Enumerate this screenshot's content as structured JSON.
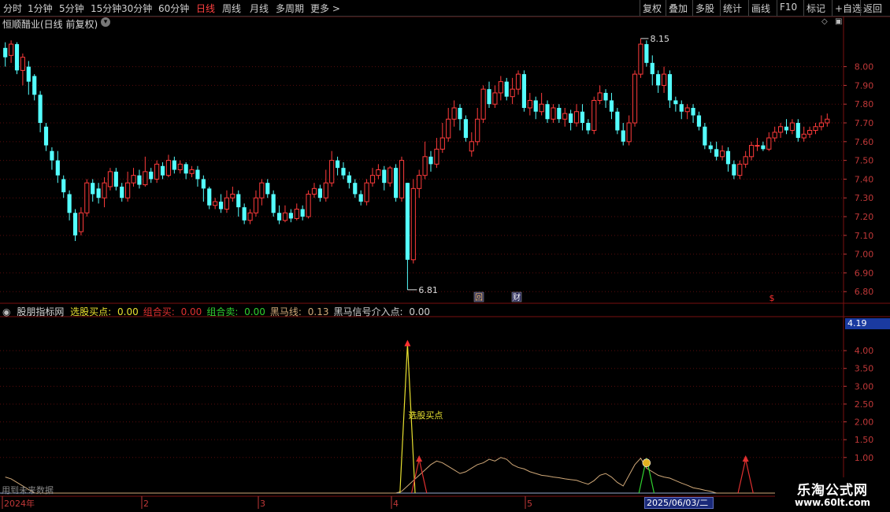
{
  "toolbar": {
    "left": [
      "分时",
      "1分钟",
      "5分钟",
      "15分钟",
      "30分钟",
      "60分钟",
      "日线",
      "周线",
      "月线",
      "多周期",
      "更多 >"
    ],
    "active": "日线",
    "right": [
      "复权",
      "叠加",
      "多股",
      "统计",
      "画线",
      "F10",
      "标记",
      "+自选",
      "返回"
    ]
  },
  "main": {
    "title": "恒顺醋业(日线 前复权)",
    "high_label": "8.15",
    "low_label": "6.81",
    "markers": {
      "review": "回",
      "finance": "财",
      "dollar": "$"
    },
    "price_ticks": [
      "8.00",
      "7.90",
      "7.80",
      "7.70",
      "7.60",
      "7.50",
      "7.40",
      "7.30",
      "7.20",
      "7.10",
      "7.00",
      "6.90",
      "6.80"
    ]
  },
  "indicator": {
    "name": "股朋指标网",
    "items": [
      {
        "label": "选股买点:",
        "value": "0.00",
        "color": "#e8e030"
      },
      {
        "label": "组合买:",
        "value": "0.00",
        "color": "#e03030"
      },
      {
        "label": "组合卖:",
        "value": "0.00",
        "color": "#30d030"
      },
      {
        "label": "黑马线:",
        "value": "0.13",
        "color": "#d0a878"
      },
      {
        "label": "黑马信号介入点:",
        "value": "0.00",
        "color": "#d0d0d0"
      }
    ],
    "current_value": "4.19",
    "ticks": [
      "4.00",
      "3.50",
      "3.00",
      "2.50",
      "2.00",
      "1.50",
      "1.00"
    ],
    "buy_label": "选股买点",
    "future_text": "用到未来数据"
  },
  "date_axis": {
    "labels": [
      "2024年",
      "2",
      "3",
      "4",
      "5"
    ],
    "cursor_date": "2025/06/03/二"
  },
  "colors": {
    "up": "#ff3b3b",
    "down": "#54ffff",
    "grid": "#7a1010",
    "axis": "#c03838"
  },
  "logo": {
    "name": "乐淘公式网",
    "url": "www.60lt.com"
  },
  "chart_data": {
    "type": "candlestick",
    "title": "恒顺醋业(日线 前复权)",
    "ylim": [
      6.78,
      8.2
    ],
    "price_high": 8.15,
    "price_low": 6.81,
    "candles": [
      [
        8.1,
        8.05,
        8.13,
        8.0
      ],
      [
        8.06,
        8.12,
        8.14,
        8.02
      ],
      [
        8.12,
        7.98,
        8.13,
        7.96
      ],
      [
        7.98,
        8.05,
        8.07,
        7.9
      ],
      [
        8.0,
        7.92,
        8.03,
        7.85
      ],
      [
        7.95,
        7.85,
        7.96,
        7.82
      ],
      [
        7.85,
        7.7,
        7.87,
        7.65
      ],
      [
        7.68,
        7.58,
        7.7,
        7.55
      ],
      [
        7.55,
        7.5,
        7.57,
        7.45
      ],
      [
        7.5,
        7.42,
        7.55,
        7.38
      ],
      [
        7.4,
        7.33,
        7.42,
        7.3
      ],
      [
        7.32,
        7.22,
        7.34,
        7.18
      ],
      [
        7.22,
        7.1,
        7.24,
        7.07
      ],
      [
        7.12,
        7.22,
        7.25,
        7.1
      ],
      [
        7.22,
        7.38,
        7.4,
        7.2
      ],
      [
        7.38,
        7.32,
        7.4,
        7.28
      ],
      [
        7.35,
        7.3,
        7.38,
        7.27
      ],
      [
        7.3,
        7.38,
        7.41,
        7.25
      ],
      [
        7.36,
        7.44,
        7.46,
        7.34
      ],
      [
        7.44,
        7.36,
        7.46,
        7.34
      ],
      [
        7.36,
        7.3,
        7.38,
        7.28
      ],
      [
        7.3,
        7.38,
        7.44,
        7.28
      ],
      [
        7.38,
        7.42,
        7.46,
        7.36
      ],
      [
        7.42,
        7.37,
        7.45,
        7.35
      ],
      [
        7.37,
        7.44,
        7.52,
        7.36
      ],
      [
        7.44,
        7.4,
        7.46,
        7.38
      ],
      [
        7.4,
        7.48,
        7.5,
        7.38
      ],
      [
        7.47,
        7.42,
        7.49,
        7.4
      ],
      [
        7.42,
        7.5,
        7.53,
        7.41
      ],
      [
        7.5,
        7.45,
        7.52,
        7.43
      ],
      [
        7.45,
        7.48,
        7.5,
        7.43
      ],
      [
        7.48,
        7.43,
        7.49,
        7.4
      ],
      [
        7.43,
        7.45,
        7.47,
        7.41
      ],
      [
        7.45,
        7.4,
        7.47,
        7.36
      ],
      [
        7.4,
        7.35,
        7.42,
        7.28
      ],
      [
        7.35,
        7.26,
        7.36,
        7.24
      ],
      [
        7.26,
        7.28,
        7.3,
        7.24
      ],
      [
        7.28,
        7.24,
        7.32,
        7.22
      ],
      [
        7.24,
        7.3,
        7.34,
        7.22
      ],
      [
        7.3,
        7.32,
        7.36,
        7.28
      ],
      [
        7.32,
        7.25,
        7.34,
        7.2
      ],
      [
        7.25,
        7.18,
        7.27,
        7.16
      ],
      [
        7.18,
        7.22,
        7.24,
        7.16
      ],
      [
        7.22,
        7.3,
        7.34,
        7.2
      ],
      [
        7.3,
        7.38,
        7.4,
        7.26
      ],
      [
        7.38,
        7.32,
        7.4,
        7.3
      ],
      [
        7.32,
        7.22,
        7.34,
        7.2
      ],
      [
        7.22,
        7.18,
        7.26,
        7.16
      ],
      [
        7.18,
        7.22,
        7.26,
        7.17
      ],
      [
        7.22,
        7.19,
        7.24,
        7.17
      ],
      [
        7.19,
        7.24,
        7.27,
        7.18
      ],
      [
        7.24,
        7.2,
        7.26,
        7.18
      ],
      [
        7.2,
        7.32,
        7.34,
        7.19
      ],
      [
        7.32,
        7.35,
        7.38,
        7.3
      ],
      [
        7.35,
        7.3,
        7.37,
        7.28
      ],
      [
        7.3,
        7.38,
        7.45,
        7.28
      ],
      [
        7.38,
        7.5,
        7.55,
        7.36
      ],
      [
        7.5,
        7.46,
        7.52,
        7.42
      ],
      [
        7.46,
        7.42,
        7.49,
        7.4
      ],
      [
        7.42,
        7.38,
        7.44,
        7.35
      ],
      [
        7.38,
        7.32,
        7.4,
        7.3
      ],
      [
        7.32,
        7.28,
        7.34,
        7.26
      ],
      [
        7.28,
        7.38,
        7.4,
        7.26
      ],
      [
        7.38,
        7.42,
        7.46,
        7.36
      ],
      [
        7.42,
        7.45,
        7.48,
        7.4
      ],
      [
        7.45,
        7.38,
        7.47,
        7.34
      ],
      [
        7.38,
        7.46,
        7.47,
        7.36
      ],
      [
        7.46,
        7.3,
        7.48,
        7.28
      ],
      [
        7.3,
        7.5,
        7.52,
        7.28
      ],
      [
        7.38,
        6.97,
        7.38,
        6.81
      ],
      [
        6.97,
        7.35,
        7.4,
        6.95
      ],
      [
        7.35,
        7.42,
        7.45,
        7.3
      ],
      [
        7.42,
        7.52,
        7.6,
        7.4
      ],
      [
        7.52,
        7.48,
        7.55,
        7.44
      ],
      [
        7.48,
        7.56,
        7.62,
        7.46
      ],
      [
        7.56,
        7.62,
        7.7,
        7.54
      ],
      [
        7.62,
        7.72,
        7.78,
        7.6
      ],
      [
        7.72,
        7.78,
        7.82,
        7.68
      ],
      [
        7.78,
        7.72,
        7.8,
        7.66
      ],
      [
        7.72,
        7.62,
        7.74,
        7.6
      ],
      [
        7.55,
        7.6,
        7.65,
        7.52
      ],
      [
        7.6,
        7.72,
        7.78,
        7.58
      ],
      [
        7.72,
        7.88,
        7.9,
        7.7
      ],
      [
        7.88,
        7.8,
        7.92,
        7.78
      ],
      [
        7.8,
        7.86,
        7.9,
        7.78
      ],
      [
        7.86,
        7.92,
        7.95,
        7.82
      ],
      [
        7.92,
        7.84,
        7.94,
        7.82
      ],
      [
        7.84,
        7.88,
        7.94,
        7.8
      ],
      [
        7.88,
        7.96,
        7.98,
        7.85
      ],
      [
        7.96,
        7.78,
        7.98,
        7.76
      ],
      [
        7.78,
        7.82,
        7.86,
        7.74
      ],
      [
        7.82,
        7.76,
        7.84,
        7.72
      ],
      [
        7.76,
        7.8,
        7.86,
        7.74
      ],
      [
        7.8,
        7.72,
        7.82,
        7.7
      ],
      [
        7.72,
        7.78,
        7.8,
        7.7
      ],
      [
        7.78,
        7.72,
        7.8,
        7.7
      ],
      [
        7.72,
        7.75,
        7.78,
        7.68
      ],
      [
        7.75,
        7.7,
        7.77,
        7.66
      ],
      [
        7.7,
        7.76,
        7.8,
        7.68
      ],
      [
        7.76,
        7.7,
        7.8,
        7.66
      ],
      [
        7.7,
        7.66,
        7.72,
        7.64
      ],
      [
        7.66,
        7.82,
        7.84,
        7.64
      ],
      [
        7.82,
        7.86,
        7.9,
        7.8
      ],
      [
        7.86,
        7.82,
        7.88,
        7.78
      ],
      [
        7.82,
        7.76,
        7.86,
        7.72
      ],
      [
        7.76,
        7.66,
        7.78,
        7.64
      ],
      [
        7.66,
        7.6,
        7.7,
        7.58
      ],
      [
        7.6,
        7.7,
        7.74,
        7.58
      ],
      [
        7.7,
        7.96,
        7.98,
        7.68
      ],
      [
        7.96,
        8.12,
        8.15,
        7.94
      ],
      [
        8.12,
        8.02,
        8.14,
        8.0
      ],
      [
        8.02,
        7.96,
        8.06,
        7.9
      ],
      [
        7.96,
        7.9,
        7.98,
        7.86
      ],
      [
        7.9,
        7.96,
        8.0,
        7.86
      ],
      [
        7.96,
        7.82,
        7.98,
        7.78
      ],
      [
        7.82,
        7.8,
        7.84,
        7.76
      ],
      [
        7.8,
        7.76,
        7.82,
        7.72
      ],
      [
        7.76,
        7.78,
        7.8,
        7.72
      ],
      [
        7.78,
        7.74,
        7.8,
        7.7
      ],
      [
        7.74,
        7.68,
        7.76,
        7.66
      ],
      [
        7.68,
        7.58,
        7.7,
        7.56
      ],
      [
        7.58,
        7.56,
        7.6,
        7.54
      ],
      [
        7.56,
        7.52,
        7.6,
        7.5
      ],
      [
        7.52,
        7.55,
        7.58,
        7.5
      ],
      [
        7.55,
        7.48,
        7.57,
        7.44
      ],
      [
        7.48,
        7.42,
        7.5,
        7.4
      ],
      [
        7.42,
        7.48,
        7.5,
        7.4
      ],
      [
        7.48,
        7.52,
        7.55,
        7.46
      ],
      [
        7.52,
        7.58,
        7.6,
        7.5
      ],
      [
        7.58,
        7.58,
        7.62,
        7.55
      ],
      [
        7.58,
        7.56,
        7.6,
        7.55
      ],
      [
        7.56,
        7.62,
        7.65,
        7.55
      ],
      [
        7.62,
        7.65,
        7.68,
        7.6
      ],
      [
        7.65,
        7.68,
        7.7,
        7.62
      ],
      [
        7.68,
        7.66,
        7.72,
        7.64
      ],
      [
        7.66,
        7.7,
        7.72,
        7.64
      ],
      [
        7.7,
        7.62,
        7.72,
        7.6
      ],
      [
        7.62,
        7.64,
        7.68,
        7.6
      ],
      [
        7.64,
        7.66,
        7.68,
        7.62
      ],
      [
        7.66,
        7.68,
        7.7,
        7.64
      ],
      [
        7.68,
        7.7,
        7.74,
        7.66
      ],
      [
        7.7,
        7.72,
        7.75,
        7.68
      ]
    ],
    "indicator_series": {
      "black_horse_line": [
        0.45,
        0.4,
        0.3,
        0.2,
        0.1,
        0,
        0,
        0,
        0,
        0,
        0,
        0,
        0,
        0,
        0,
        0,
        0,
        0,
        0,
        0,
        0,
        0,
        0,
        0,
        0,
        0,
        0,
        0,
        0,
        0,
        0,
        0,
        0,
        0,
        0,
        0,
        0,
        0,
        0,
        0,
        0,
        0,
        0,
        0,
        0,
        0,
        0,
        0,
        0,
        0,
        0,
        0,
        0,
        0,
        0,
        0,
        0,
        0,
        0,
        0,
        0,
        0,
        0,
        0,
        0,
        0,
        0,
        0,
        0.05,
        0.2,
        0.35,
        0.5,
        0.65,
        0.8,
        0.9,
        0.85,
        0.75,
        0.65,
        0.55,
        0.6,
        0.7,
        0.8,
        0.85,
        0.95,
        0.9,
        1.0,
        0.95,
        0.8,
        0.72,
        0.68,
        0.6,
        0.55,
        0.5,
        0.48,
        0.45,
        0.43,
        0.4,
        0.38,
        0.36,
        0.3,
        0.25,
        0.35,
        0.5,
        0.55,
        0.45,
        0.3,
        0.2,
        0.5,
        0.8,
        0.98,
        0.7,
        0.6,
        0.5,
        0.45,
        0.42,
        0.35,
        0.28,
        0.22,
        0.15,
        0.12,
        0.08,
        0.05,
        0,
        0,
        0,
        0,
        0,
        0,
        0,
        0,
        0,
        0,
        0,
        0,
        0,
        0,
        0,
        0,
        0,
        0
      ],
      "buy_point_spike": {
        "index": 69,
        "value": 4.19
      },
      "combo_buy_spikes": [
        {
          "index": 71,
          "value": 0.95
        },
        {
          "index": 127,
          "value": 0.95
        }
      ],
      "combo_sell_spike": {
        "index": 110,
        "value": 0.98
      }
    }
  }
}
